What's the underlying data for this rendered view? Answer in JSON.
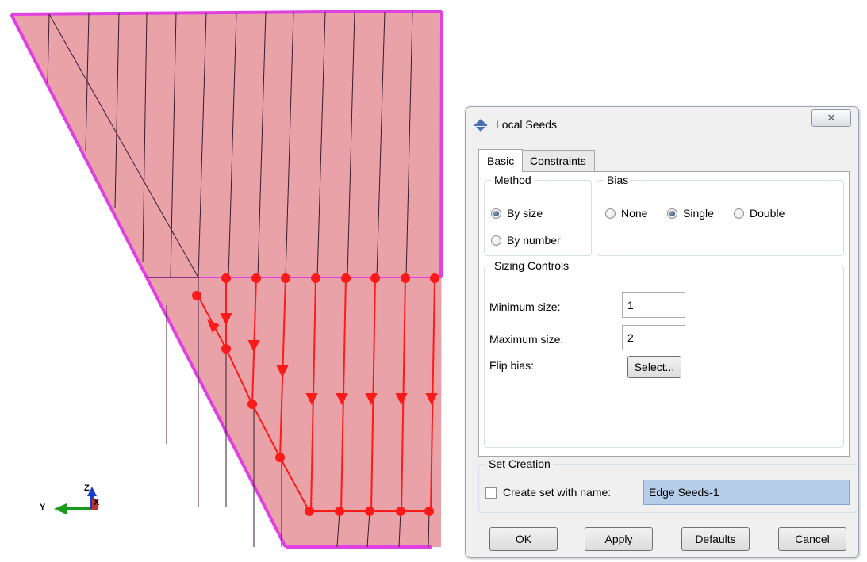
{
  "viewport": {
    "triad": {
      "z_label": "Z",
      "x_label": "X",
      "y_label": "Y"
    }
  },
  "dialog": {
    "title": "Local Seeds",
    "close_symbol": "✕",
    "tabs": [
      {
        "label": "Basic",
        "active": true
      },
      {
        "label": "Constraints",
        "active": false
      }
    ],
    "method": {
      "legend": "Method",
      "options": [
        {
          "label": "By size",
          "selected": true
        },
        {
          "label": "By number",
          "selected": false
        }
      ]
    },
    "bias": {
      "legend": "Bias",
      "options": [
        {
          "label": "None",
          "selected": false
        },
        {
          "label": "Single",
          "selected": true
        },
        {
          "label": "Double",
          "selected": false
        }
      ]
    },
    "sizing": {
      "legend": "Sizing Controls",
      "min_label": "Minimum size:",
      "min_value": "1",
      "max_label": "Maximum size:",
      "max_value": "2",
      "flip_label": "Flip bias:",
      "select_button": "Select..."
    },
    "set_creation": {
      "legend": "Set Creation",
      "checkbox_label": "Create set with name:",
      "checked": false,
      "name_value": "Edge Seeds-1"
    },
    "buttons": {
      "ok": "OK",
      "apply": "Apply",
      "defaults": "Defaults",
      "cancel": "Cancel"
    }
  },
  "colors": {
    "part_fill": "#e8a2a8",
    "seed_magenta": "#e040e0",
    "selected_edge_red": "#ff1a1a",
    "dialog_bg": "#f0f0f0"
  }
}
